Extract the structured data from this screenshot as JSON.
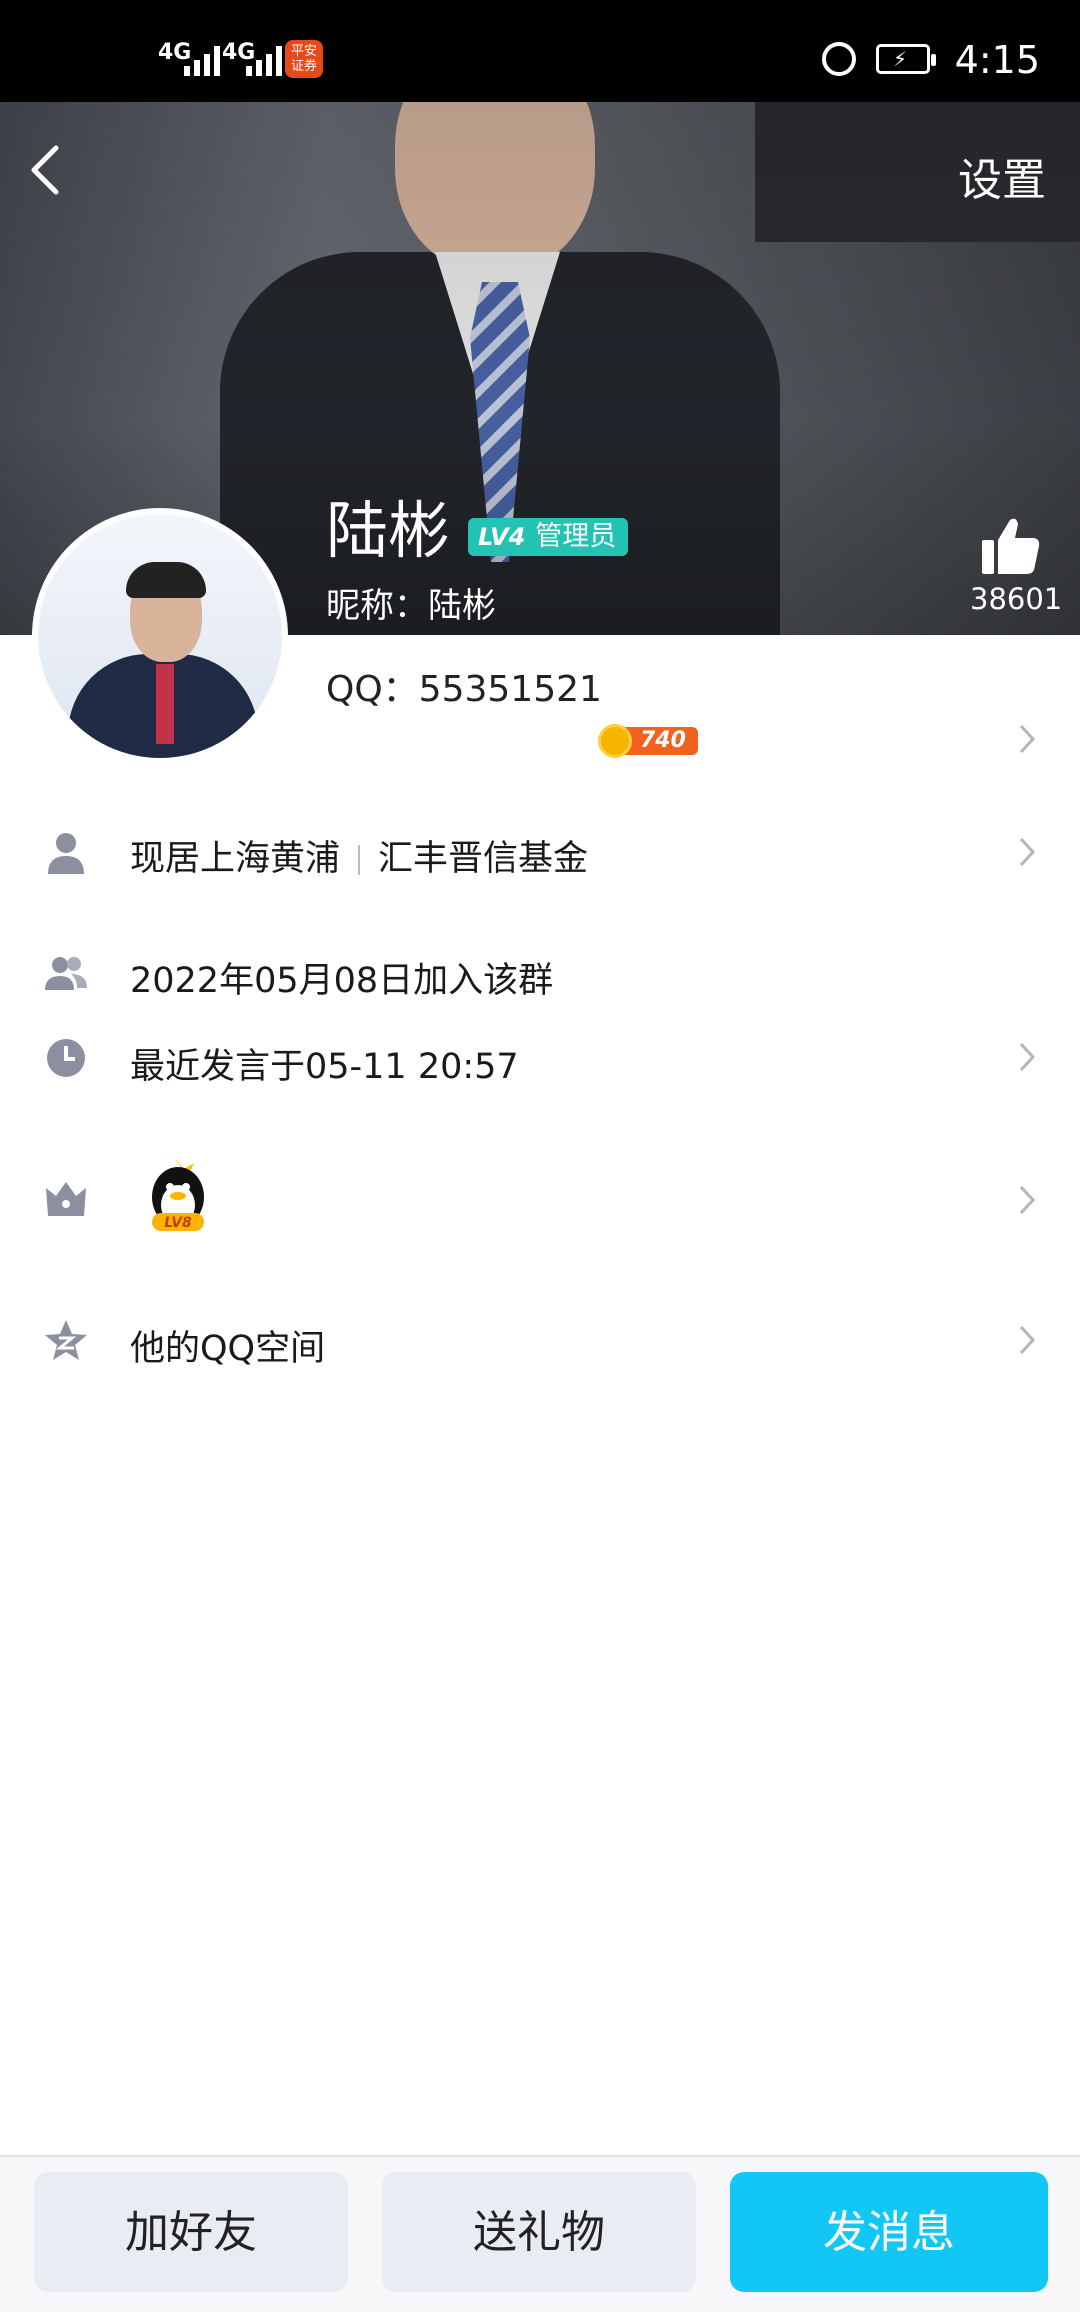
{
  "status_bar": {
    "signal_1": "4G",
    "signal_2": "4G",
    "app_badge": "平安证券",
    "time": "4:15"
  },
  "header": {
    "back_label": "返回",
    "settings_label": "设置"
  },
  "profile": {
    "name": "陆彬",
    "badge_level": "LV4",
    "badge_role": "管理员",
    "nickname_line": "昵称：陆彬",
    "qq_line": "QQ：55351521",
    "likes": "38601",
    "coin_value": "740"
  },
  "rows": {
    "location": "现居上海黄浦",
    "company": "汇丰晋信基金",
    "join_date": "2022年05月08日加入该群",
    "last_speak": "最近发言于05-11 20:57",
    "level_badge": "LV8",
    "qzone": "他的QQ空间"
  },
  "buttons": {
    "add_friend": "加好友",
    "send_gift": "送礼物",
    "send_message": "发消息"
  },
  "colors": {
    "accent": "#12C7F5",
    "role_badge": "#23C3B3",
    "coin": "#F2611D"
  }
}
